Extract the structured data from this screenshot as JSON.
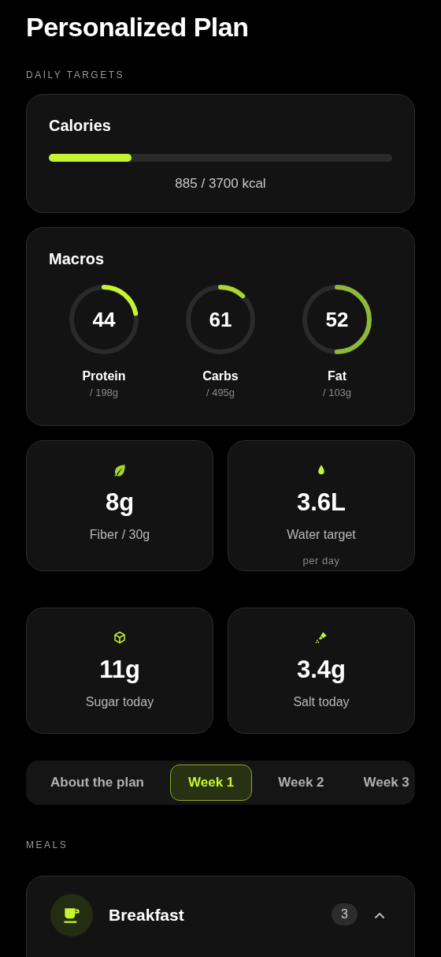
{
  "title": "Personalized Plan",
  "daily_targets": {
    "label": "DAILY TARGETS",
    "calories": {
      "title": "Calories",
      "level": 0.24,
      "reading": "885 / 3700 kcal"
    },
    "macros": {
      "title": "Macros",
      "items": [
        {
          "value": "44",
          "name": "Protein",
          "target": "/ 198g",
          "level": 0.22,
          "color": "#c6f432"
        },
        {
          "value": "61",
          "name": "Carbs",
          "target": "/ 495g",
          "level": 0.12,
          "color": "#a9d631"
        },
        {
          "value": "52",
          "name": "Fat",
          "target": "/ 103g",
          "level": 0.5,
          "color": "#8db83a"
        }
      ]
    },
    "stats": [
      {
        "kind": "leaf",
        "value": "8g",
        "label": "Fiber / 30g"
      },
      {
        "kind": "drop",
        "value": "3.6L",
        "label": "Water target",
        "note": "per day"
      },
      {
        "kind": "cube",
        "value": "11g",
        "label": "Sugar today"
      },
      {
        "kind": "salt",
        "value": "3.4g",
        "label": "Salt today"
      }
    ]
  },
  "tabs": [
    {
      "label": "About the plan",
      "selected": false
    },
    {
      "label": "Week 1",
      "selected": true
    },
    {
      "label": "Week 2",
      "selected": false
    },
    {
      "label": "Week 3",
      "selected": false
    }
  ],
  "meals": {
    "label": "MEALS",
    "items": [
      {
        "kind": "cup",
        "title": "Breakfast",
        "count": "3",
        "expanded": true
      }
    ]
  }
}
